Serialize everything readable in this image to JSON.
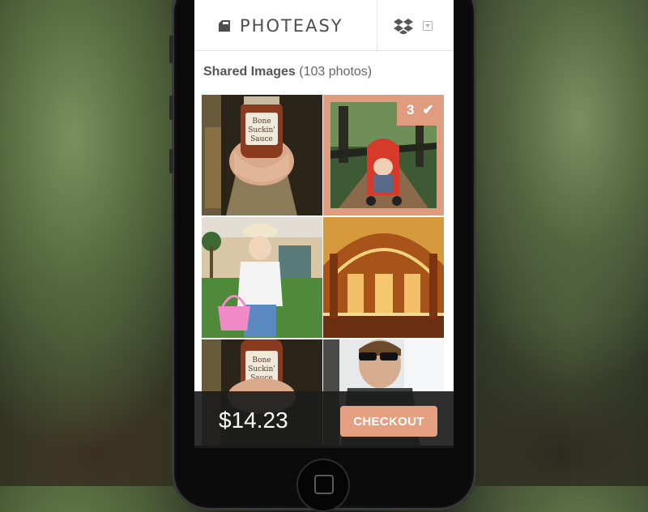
{
  "app": {
    "name": "PHOTEASY",
    "logo_icon": "photo-stack-icon"
  },
  "header": {
    "storage_icon": "dropbox-icon",
    "menu_icon": "chevron-down-icon"
  },
  "gallery": {
    "title": "Shared Images",
    "count_label": "(103 photos)",
    "photos": [
      {
        "subject": "Bone Suckin' Sauce jar held in hands",
        "selected": false
      },
      {
        "subject": "baby in red stroller on suspension bridge",
        "selected": true,
        "badge_count": "3"
      },
      {
        "subject": "toddler with hat and pink basket on lawn",
        "selected": false
      },
      {
        "subject": "grand train station interior with arched ceiling",
        "selected": false
      },
      {
        "subject": "Bone Suckin' Sauce jar held in hands",
        "selected": false
      },
      {
        "subject": "man wearing sunglasses near window",
        "selected": false
      }
    ]
  },
  "photo_text": {
    "jar_label_line1": "Bone",
    "jar_label_line2": "Suckin'",
    "jar_label_line3": "Sauce"
  },
  "checkout_bar": {
    "price": "$14.23",
    "button_label": "CHECKOUT"
  },
  "colors": {
    "accent": "#e09c7e",
    "button": "#e5a081",
    "bar_bg": "#1c1c1c"
  }
}
